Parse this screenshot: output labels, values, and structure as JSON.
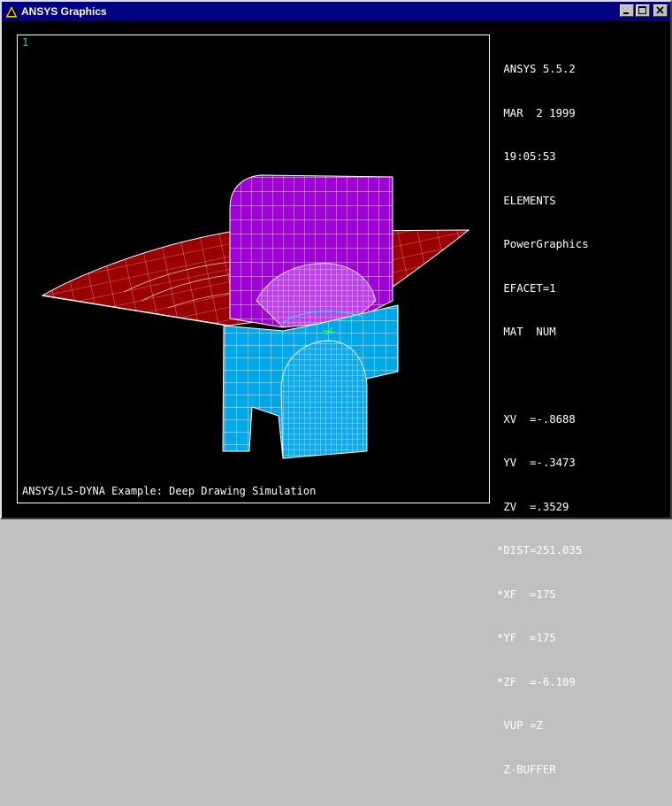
{
  "window": {
    "title": "ANSYS Graphics",
    "controls": {
      "minimize": "_",
      "maximize": "□",
      "close": "×"
    }
  },
  "viewport": {
    "window_number": "1",
    "caption": "ANSYS/LS-DYNA Example: Deep Drawing Simulation"
  },
  "legend": {
    "info_lines": [
      " ANSYS 5.5.2",
      " MAR  2 1999",
      " 19:05:53",
      " ELEMENTS",
      " PowerGraphics",
      " EFACET=1",
      " MAT  NUM"
    ],
    "view_lines": [
      " XV  =-.8688",
      " YV  =-.3473",
      " ZV  =.3529",
      "*DIST=251.035",
      "*XF  =175",
      "*YF  =175",
      "*ZF  =-6.109",
      " VUP =Z",
      " Z-BUFFER"
    ]
  },
  "colors": {
    "title_bar": "#000080",
    "blank_sheet": "#9b0000",
    "punch_upper": "#a000d8",
    "die_lower": "#00a8e8",
    "mesh_lines": "#ffffff",
    "annotation_cyan": "#00d0d0"
  }
}
